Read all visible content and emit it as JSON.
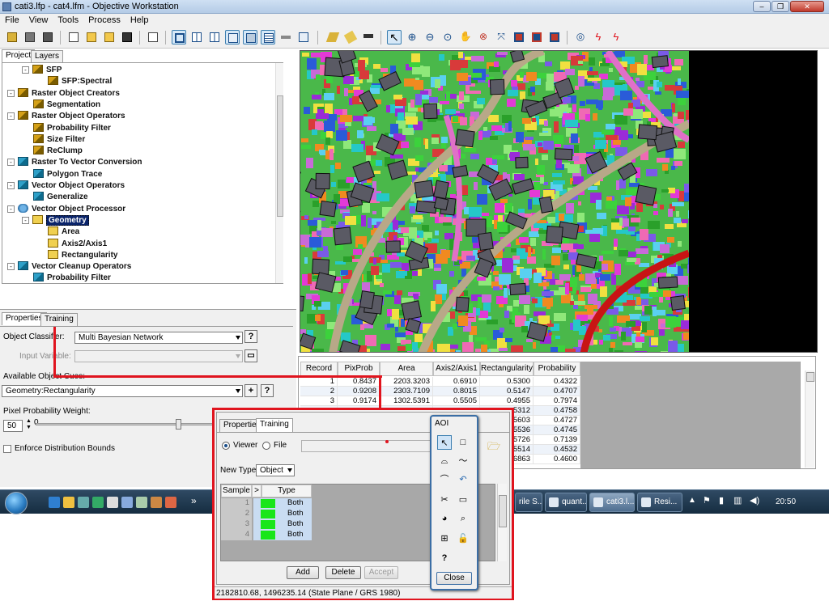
{
  "window": {
    "title": "cati3.lfp - cat4.lfm - Objective Workstation"
  },
  "menu": [
    "File",
    "View",
    "Tools",
    "Process",
    "Help"
  ],
  "project_tabs": [
    "Project",
    "Layers"
  ],
  "tree": [
    {
      "label": "SFP",
      "icon": "raster-icon",
      "indent": 2,
      "expander": "-"
    },
    {
      "label": "SFP:Spectral",
      "icon": "raster-icon",
      "indent": 3,
      "expander": ""
    },
    {
      "label": "Raster Object Creators",
      "icon": "raster-icon",
      "indent": 1,
      "expander": "-"
    },
    {
      "label": "Segmentation",
      "icon": "raster-icon",
      "indent": 2,
      "expander": ""
    },
    {
      "label": "Raster Object Operators",
      "icon": "raster-icon",
      "indent": 1,
      "expander": "-"
    },
    {
      "label": "Probability Filter",
      "icon": "raster-icon",
      "indent": 2,
      "expander": ""
    },
    {
      "label": "Size Filter",
      "icon": "raster-icon",
      "indent": 2,
      "expander": ""
    },
    {
      "label": "ReClump",
      "icon": "raster-icon",
      "indent": 2,
      "expander": ""
    },
    {
      "label": "Raster To Vector Conversion",
      "icon": "vector-icon",
      "indent": 1,
      "expander": "-"
    },
    {
      "label": "Polygon Trace",
      "icon": "vector-icon",
      "indent": 2,
      "expander": ""
    },
    {
      "label": "Vector Object Operators",
      "icon": "vector-icon",
      "indent": 1,
      "expander": "-"
    },
    {
      "label": "Generalize",
      "icon": "vector-icon",
      "indent": 2,
      "expander": ""
    },
    {
      "label": "Vector Object Processor",
      "icon": "globe-icon",
      "indent": 1,
      "expander": "-"
    },
    {
      "label": "Geometry",
      "icon": "geometry-icon",
      "indent": 2,
      "expander": "-",
      "selected": true
    },
    {
      "label": "Area",
      "icon": "geometry-icon",
      "indent": 3,
      "expander": ""
    },
    {
      "label": "Axis2/Axis1",
      "icon": "geometry-icon",
      "indent": 3,
      "expander": ""
    },
    {
      "label": "Rectangularity",
      "icon": "geometry-icon",
      "indent": 3,
      "expander": ""
    },
    {
      "label": "Vector Cleanup Operators",
      "icon": "vector-icon",
      "indent": 1,
      "expander": "-"
    },
    {
      "label": "Probability Filter",
      "icon": "vector-icon",
      "indent": 2,
      "expander": ""
    }
  ],
  "props": {
    "tabs": [
      "Properties",
      "Training"
    ],
    "object_classifier_label": "Object Classifier:",
    "object_classifier_value": "Multi Bayesian Network",
    "input_variable_label": "Input Variable:",
    "available_object_cues_label": "Available Object Cues:",
    "available_object_cues_value": "Geometry:Rectangularity",
    "pixel_probability_label": "Pixel Probability Weight:",
    "pixel_probability_value": "50",
    "slider_min": "0",
    "slider_fraction": 0.5,
    "enforce_label": "Enforce Distribution Bounds",
    "help_glyph": "?",
    "add_glyph": "+"
  },
  "table": {
    "headers": [
      "Record",
      "PixProb",
      "Area",
      "Axis2/Axis1",
      "Rectangularity",
      "Probability"
    ],
    "rows": [
      [
        "1",
        "0.8437",
        "2203.3203",
        "0.6910",
        "0.5300",
        "0.4322"
      ],
      [
        "2",
        "0.9208",
        "2303.7109",
        "0.8015",
        "0.5147",
        "0.4707"
      ],
      [
        "3",
        "0.9174",
        "1302.5391",
        "0.5505",
        "0.4955",
        "0.7974"
      ],
      [
        "",
        "",
        "",
        "",
        "5312",
        "0.4758"
      ],
      [
        "",
        "",
        "",
        "",
        "5603",
        "0.4727"
      ],
      [
        "",
        "",
        "",
        "",
        "5536",
        "0.4745"
      ],
      [
        "",
        "",
        "",
        "",
        "5726",
        "0.7139"
      ],
      [
        "",
        "",
        "",
        "",
        "5514",
        "0.4532"
      ],
      [
        "",
        "",
        "",
        "",
        "6863",
        "0.4600"
      ]
    ]
  },
  "training": {
    "tabs": [
      "Properties",
      "Training"
    ],
    "source_viewer": "Viewer",
    "source_file": "File",
    "new_type_label": "New Type:",
    "new_type_value": "Object",
    "grid_headers": [
      "Sample",
      ">",
      "Type"
    ],
    "samples": [
      {
        "n": "1",
        "type": "Both"
      },
      {
        "n": "2",
        "type": "Both"
      },
      {
        "n": "3",
        "type": "Both"
      },
      {
        "n": "4",
        "type": "Both"
      }
    ],
    "sample_color": "#19e619",
    "add_label": "Add",
    "delete_label": "Delete",
    "accept_label": "Accept",
    "status": "2182810.68, 1496235.14   (State Plane / GRS 1980)"
  },
  "aoi": {
    "title": "AOI",
    "close_label": "Close",
    "help_glyph": "?"
  },
  "taskbar": {
    "tasks": [
      "rile S...",
      "quant...",
      "cati3.l...",
      "Resi..."
    ],
    "clock": "20:50",
    "overflow": "»"
  },
  "colors": {
    "highlight": "#e0141e",
    "selection": "#0a246a"
  }
}
